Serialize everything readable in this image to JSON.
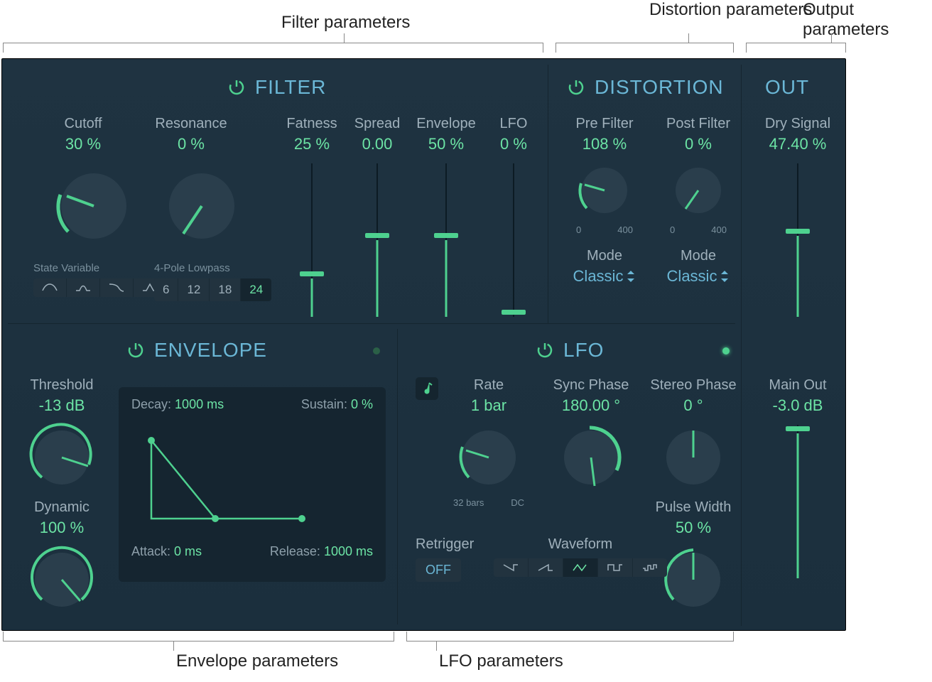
{
  "callouts": {
    "filter": "Filter parameters",
    "distortion": "Distortion parameters",
    "output": "Output parameters",
    "envelope": "Envelope parameters",
    "lfo": "LFO parameters"
  },
  "filter": {
    "title": "FILTER",
    "cutoff": {
      "label": "Cutoff",
      "value": "30 %"
    },
    "resonance": {
      "label": "Resonance",
      "value": "0 %"
    },
    "fatness": {
      "label": "Fatness",
      "value": "25 %"
    },
    "spread": {
      "label": "Spread",
      "value": "0.00"
    },
    "envelope": {
      "label": "Envelope",
      "value": "50 %"
    },
    "lfo": {
      "label": "LFO",
      "value": "0 %"
    },
    "stateVarLabel": "State Variable",
    "lowpassLabel": "4-Pole Lowpass",
    "poles": [
      "6",
      "12",
      "18",
      "24"
    ]
  },
  "distortion": {
    "title": "DISTORTION",
    "pre": {
      "label": "Pre Filter",
      "value": "108 %",
      "min": "0",
      "max": "400"
    },
    "post": {
      "label": "Post Filter",
      "value": "0 %",
      "min": "0",
      "max": "400"
    },
    "modeLabel": "Mode",
    "modeValue": "Classic"
  },
  "out": {
    "title": "OUT",
    "dry": {
      "label": "Dry Signal",
      "value": "47.40 %"
    },
    "main": {
      "label": "Main Out",
      "value": "-3.0 dB"
    }
  },
  "envelope": {
    "title": "ENVELOPE",
    "threshold": {
      "label": "Threshold",
      "value": "-13 dB"
    },
    "dynamic": {
      "label": "Dynamic",
      "value": "100 %"
    },
    "decayLabel": "Decay:",
    "decayValue": "1000 ms",
    "sustainLabel": "Sustain:",
    "sustainValue": "0 %",
    "attackLabel": "Attack:",
    "attackValue": "0 ms",
    "releaseLabel": "Release:",
    "releaseValue": "1000 ms"
  },
  "lfo": {
    "title": "LFO",
    "rate": {
      "label": "Rate",
      "value": "1 bar",
      "min": "32 bars",
      "max": "DC"
    },
    "syncPhase": {
      "label": "Sync Phase",
      "value": "180.00 °"
    },
    "stereoPhase": {
      "label": "Stereo Phase",
      "value": "0 °"
    },
    "pulseWidth": {
      "label": "Pulse Width",
      "value": "50 %"
    },
    "retriggerLabel": "Retrigger",
    "retriggerValue": "OFF",
    "waveformLabel": "Waveform"
  }
}
